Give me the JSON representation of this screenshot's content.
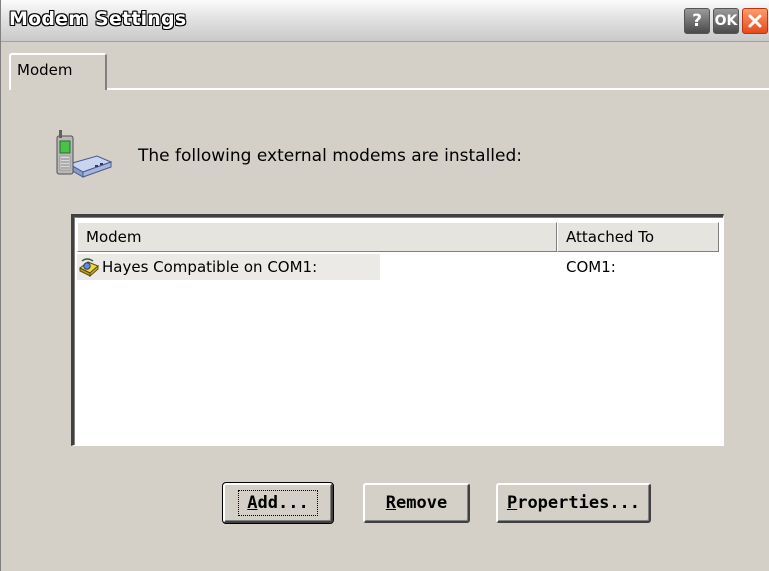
{
  "window": {
    "title": "Modem Settings",
    "help_button": "?",
    "ok_button": "OK"
  },
  "tabs": [
    {
      "label": "Modem"
    }
  ],
  "main": {
    "intro_text": "The following external modems are installed:"
  },
  "list": {
    "columns": [
      "Modem",
      "Attached To"
    ],
    "rows": [
      {
        "modem": "Hayes Compatible on COM1:",
        "attached_to": "COM1:"
      }
    ]
  },
  "buttons": {
    "add": {
      "mnemonic": "A",
      "rest": "dd..."
    },
    "remove": {
      "mnemonic": "R",
      "rest": "emove"
    },
    "properties": {
      "mnemonic": "P",
      "rest": "roperties..."
    }
  },
  "icons": {
    "header": "phone-modem-icon",
    "row": "modem-device-icon",
    "close": "close-icon"
  }
}
